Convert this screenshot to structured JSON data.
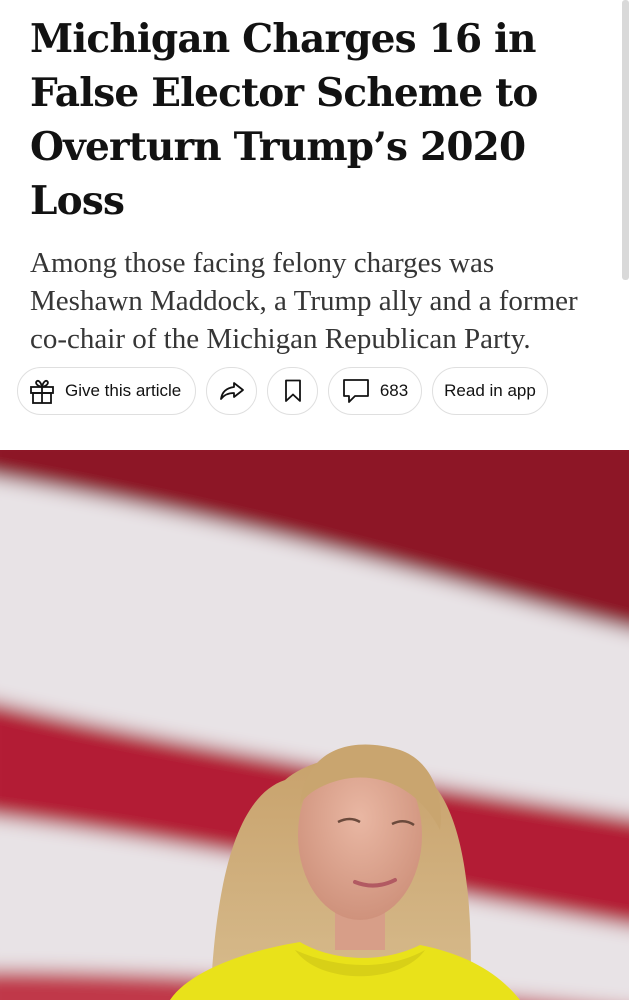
{
  "article": {
    "headline": "Michigan Charges 16 in False Elector Scheme to Overturn Trump’s 2020 Loss",
    "summary": "Among those facing felony charges was Meshawn Maddock, a Trump ally and a former co-chair of the Michigan Republican Party."
  },
  "toolbar": {
    "gift_label": "Give this article",
    "gift_icon": "gift-icon",
    "share_icon": "share-icon",
    "save_icon": "bookmark-icon",
    "comments_icon": "comment-icon",
    "comments_count": "683",
    "read_in_app_label": "Read in app"
  },
  "photo": {
    "subject": "woman in yellow dress in front of an American flag",
    "colors": {
      "stripe_red": "#b31d35",
      "stripe_white": "#e8e3e6",
      "dress_yellow": "#e9e21a"
    }
  }
}
